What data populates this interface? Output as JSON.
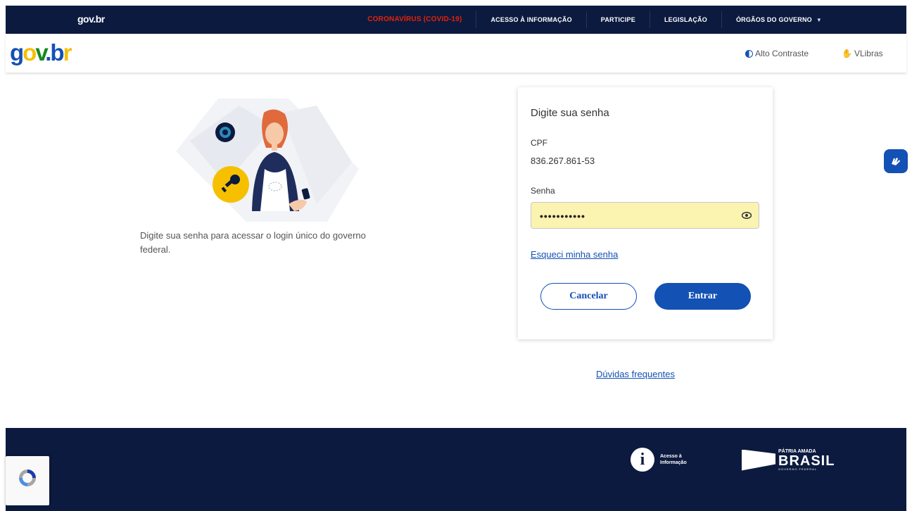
{
  "topbar": {
    "logo": "gov.br",
    "menu": [
      {
        "label": "CORONAVÍRUS (COVID-19)",
        "highlight": true
      },
      {
        "label": "ACESSO À INFORMAÇÃO"
      },
      {
        "label": "PARTICIPE"
      },
      {
        "label": "LEGISLAÇÃO"
      },
      {
        "label": "ÓRGÃOS DO GOVERNO"
      }
    ]
  },
  "header": {
    "brand": "gov.br",
    "contrast": "Alto Contraste",
    "vlibras": "VLibras"
  },
  "intro": {
    "description": "Digite sua senha para acessar o login único do governo federal."
  },
  "login": {
    "title": "Digite sua senha",
    "cpf_label": "CPF",
    "cpf_value": "836.267.861-53",
    "password_label": "Senha",
    "password_value": "•••••••••••",
    "forgot": "Esqueci minha senha",
    "cancel": "Cancelar",
    "enter": "Entrar"
  },
  "faq": "Dúvidas frequentes",
  "footer": {
    "acesso": "Acesso à Informação",
    "patria": "PÁTRIA AMADA",
    "brasil": "BRASIL",
    "governo": "GOVERNO FEDERAL"
  },
  "colors": {
    "navy": "#0c1a3f",
    "primary": "#1351b4",
    "covid": "#e52207",
    "autofill": "#fbf3b0"
  }
}
